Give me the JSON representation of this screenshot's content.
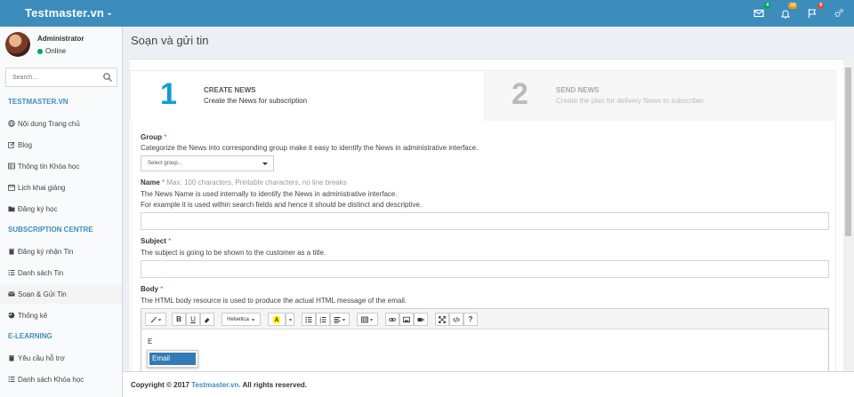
{
  "header": {
    "brand": "Testmaster.vn -",
    "icons": [
      {
        "name": "envelope-icon",
        "badge": "4",
        "badge_color": "#00a65a"
      },
      {
        "name": "bell-icon",
        "badge": "10",
        "badge_color": "#f39c12"
      },
      {
        "name": "flag-icon",
        "badge": "9",
        "badge_color": "#dd4b39"
      },
      {
        "name": "gears-icon",
        "badge": ""
      }
    ]
  },
  "sidebar": {
    "user": {
      "name": "Administrator",
      "status": "Online"
    },
    "search": {
      "placeholder": "Search..."
    },
    "sections": [
      {
        "header": "TESTMASTER.VN",
        "items": [
          {
            "label": "Nội dung Trang chủ",
            "icon": "globe-icon"
          },
          {
            "label": "Blog",
            "icon": "edit-icon"
          },
          {
            "label": "Thông tin Khóa học",
            "icon": "table-icon"
          },
          {
            "label": "Lịch khai giảng",
            "icon": "calendar-icon"
          },
          {
            "label": "Đăng ký học",
            "icon": "folder-icon"
          }
        ]
      },
      {
        "header": "SUBSCRIPTION CENTRE",
        "items": [
          {
            "label": "Đăng ký nhận Tin",
            "icon": "book-icon"
          },
          {
            "label": "Danh sách Tin",
            "icon": "list-icon"
          },
          {
            "label": "Soạn & Gửi Tin",
            "icon": "envelope-icon",
            "active": true
          },
          {
            "label": "Thống kê",
            "icon": "pie-chart-icon"
          }
        ]
      },
      {
        "header": "E-LEARNING",
        "items": [
          {
            "label": "Yêu cầu hỗ trợ",
            "icon": "book-icon"
          },
          {
            "label": "Danh sách Khóa học",
            "icon": "list-icon"
          }
        ]
      }
    ]
  },
  "page": {
    "title": "Soạn và gửi tin"
  },
  "wizard": {
    "steps": [
      {
        "number": "1",
        "title": "CREATE NEWS",
        "desc": "Create the News for subscription"
      },
      {
        "number": "2",
        "title": "SEND NEWS",
        "desc": "Create the plan for delivery News to subscriber"
      }
    ]
  },
  "form": {
    "group": {
      "label": "Group",
      "required": "*",
      "help": "Categorize the News into corresponding group make it easy to identify the News in administrative interface.",
      "select_value": "Select group..."
    },
    "name": {
      "label": "Name",
      "required": "*",
      "hint": "Max. 100 characters, Printable characters, no line breaks",
      "help1": "The News Name is used internally to identify the News in administrative interface.",
      "help2": "For example it is used within search fields and hence it should be distinct and descriptive.",
      "value": ""
    },
    "subject": {
      "label": "Subject",
      "required": "*",
      "help": "The subject is going to be shown to the customer as a title.",
      "value": ""
    },
    "body": {
      "label": "Body",
      "required": "*",
      "help": "The HTML body resource is used to produce the actual HTML message of the email.",
      "font_label": "Helvetica",
      "content": "E",
      "autocomplete": [
        "Email"
      ]
    }
  },
  "footer": {
    "prefix": "Copyright © 2017",
    "link": "Testmaster.vn.",
    "suffix": "All rights reserved."
  }
}
